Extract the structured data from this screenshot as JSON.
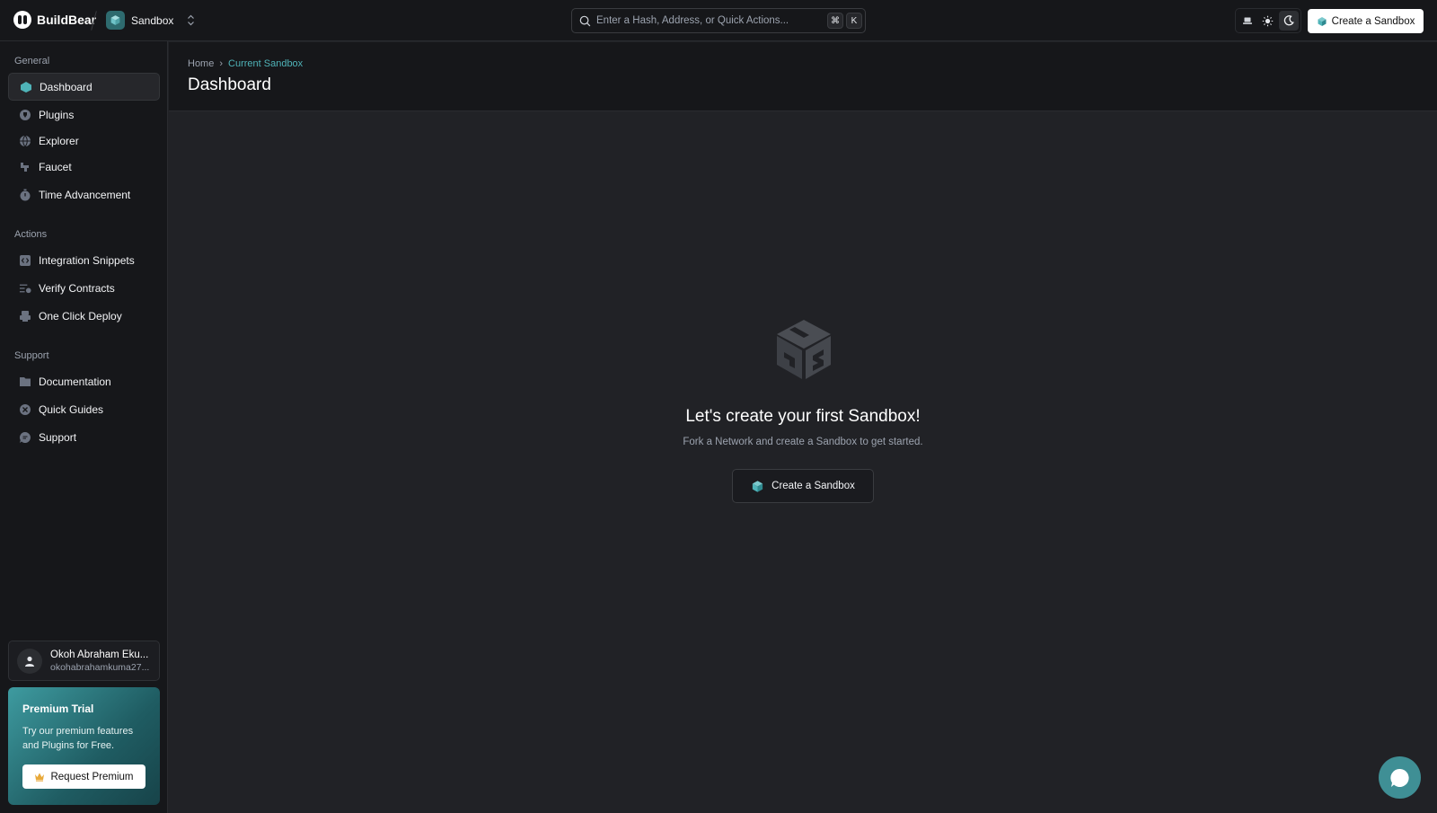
{
  "app": {
    "brand": "BuildBear"
  },
  "topbar": {
    "sandbox_label": "Sandbox",
    "search_placeholder": "Enter a Hash, Address, or Quick Actions...",
    "shortcut_cmd": "⌘",
    "shortcut_key": "K",
    "create_label": "Create a Sandbox"
  },
  "sidebar": {
    "sections": [
      {
        "title": "General",
        "items": [
          {
            "label": "Dashboard",
            "icon": "dashboard-icon",
            "active": true
          },
          {
            "label": "Plugins",
            "icon": "plugins-icon"
          },
          {
            "label": "Explorer",
            "icon": "globe-icon"
          },
          {
            "label": "Faucet",
            "icon": "faucet-icon"
          },
          {
            "label": "Time Advancement",
            "icon": "clock-icon"
          }
        ]
      },
      {
        "title": "Actions",
        "items": [
          {
            "label": "Integration Snippets",
            "icon": "code-icon"
          },
          {
            "label": "Verify Contracts",
            "icon": "verify-icon"
          },
          {
            "label": "One Click Deploy",
            "icon": "deploy-icon"
          }
        ]
      },
      {
        "title": "Support",
        "items": [
          {
            "label": "Documentation",
            "icon": "folder-icon"
          },
          {
            "label": "Quick Guides",
            "icon": "guide-icon"
          },
          {
            "label": "Support",
            "icon": "chat-icon"
          }
        ]
      }
    ],
    "user": {
      "name": "Okoh Abraham Eku...",
      "email": "okohabrahamkuma27..."
    },
    "premium": {
      "title": "Premium Trial",
      "description": "Try our premium features and Plugins for Free.",
      "button_label": "Request Premium"
    }
  },
  "header": {
    "breadcrumb": [
      "Home",
      "Current Sandbox"
    ],
    "title": "Dashboard"
  },
  "empty_state": {
    "title": "Let's create your first Sandbox!",
    "subtitle": "Fork a Network and create a Sandbox to get started.",
    "button_label": "Create a Sandbox"
  },
  "colors": {
    "accent": "#4fb3b8",
    "background": "#212226",
    "panel": "#16171a"
  }
}
